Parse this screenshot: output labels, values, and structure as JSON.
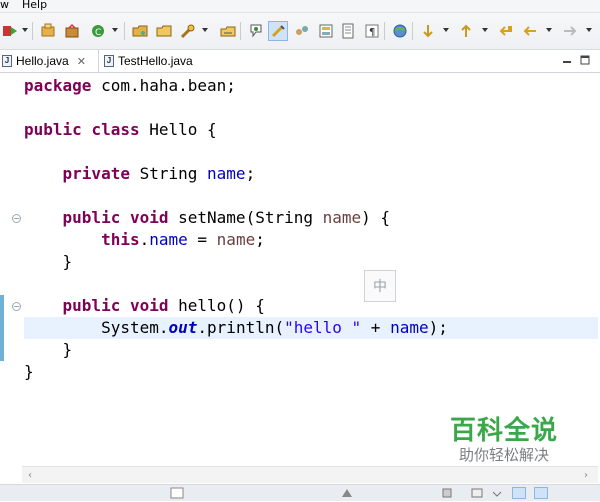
{
  "menu": {
    "items": [
      "w",
      "Help"
    ]
  },
  "tabs": [
    {
      "label": "Hello.java",
      "close": "✕",
      "active": true
    },
    {
      "label": "TestHello.java",
      "active": false
    }
  ],
  "toolbar": {
    "icons": [
      "run-icon",
      "debug-icon",
      "external-tools-icon",
      "new-java-project-icon",
      "new-package-icon",
      "new-class-icon",
      "open-type-icon",
      "search-icon",
      "annotation-icon",
      "mark-occurrences-icon",
      "toggle-breadcrumb-icon",
      "block-selection-icon",
      "show-whitespace-icon",
      "globe-icon",
      "next-annotation-icon",
      "prev-annotation-icon",
      "last-edit-icon",
      "back-icon",
      "forward-icon"
    ]
  },
  "code": {
    "lines": [
      [
        "package",
        " com.haha.bean;"
      ],
      [],
      [
        "public",
        " ",
        "class",
        " Hello {"
      ],
      [],
      [
        "    ",
        "private",
        " String ",
        "name",
        ";"
      ],
      [],
      [
        "    ",
        "public",
        " ",
        "void",
        " setName(String ",
        "name",
        ") {"
      ],
      [
        "        ",
        "this",
        ".",
        "name",
        " = ",
        "name",
        ";"
      ],
      [
        "    }"
      ],
      [],
      [
        "    ",
        "public",
        " ",
        "void",
        " hello() {"
      ],
      [
        "        System.",
        "out",
        ".println(",
        "\"hello \"",
        " + ",
        "name",
        ");"
      ],
      [
        "    }"
      ],
      [
        "}"
      ]
    ]
  },
  "ime": {
    "label": "中"
  },
  "watermark": {
    "title": "百科全说",
    "subtitle": "助你轻松解决"
  },
  "colors": {
    "keyword": "#7f0055",
    "field": "#0000c0",
    "string": "#2a00ff",
    "current_line": "#e8f2fe",
    "watermark_green": "#3aa84a"
  }
}
